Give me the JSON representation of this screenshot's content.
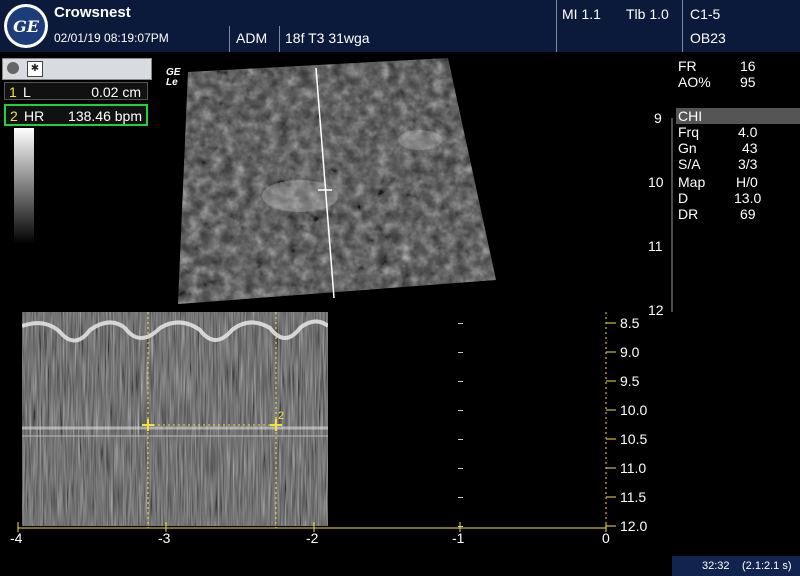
{
  "header": {
    "logo_text": "GE",
    "institution": "Crowsnest",
    "datetime": "02/01/19 08:19:07PM",
    "operator": "ADM",
    "exam": "18f T3 31wga",
    "mi": "MI 1.1",
    "tib": "Tlb 1.0",
    "probe": "C1-5",
    "preset": "OB23"
  },
  "measurements": [
    {
      "index": "1",
      "name": "L",
      "value": "0.02 cm"
    },
    {
      "index": "2",
      "name": "HR",
      "value": "138.46 bpm"
    }
  ],
  "image_mark": {
    "line1": "GE",
    "line2": "Le"
  },
  "params": [
    {
      "name": "FR",
      "value": "16"
    },
    {
      "name": "AO%",
      "value": "95"
    },
    {
      "name": "CHI",
      "value": ""
    },
    {
      "name": "Frq",
      "value": "4.0"
    },
    {
      "name": "Gn",
      "value": "43"
    },
    {
      "name": "S/A",
      "value": "3/3"
    },
    {
      "name": "Map",
      "value": "H/0"
    },
    {
      "name": "D",
      "value": "13.0"
    },
    {
      "name": "DR",
      "value": "69"
    }
  ],
  "bmode_depth_marks": [
    "9",
    "10",
    "11",
    "12"
  ],
  "mmode_depth_scale": [
    "8.5",
    "9.0",
    "9.5",
    "10.0",
    "10.5",
    "11.0",
    "11.5",
    "12.0"
  ],
  "time_axis": [
    "-4",
    "-3",
    "-2",
    "-1",
    "0"
  ],
  "caliper_label": "2",
  "status": {
    "counter": "32:32",
    "loop": "(2.1:2.1 s)"
  },
  "colors": {
    "caliper": "#f2e23b",
    "header_bg": "#0b1a3a",
    "active_box": "#1fcf3e"
  }
}
